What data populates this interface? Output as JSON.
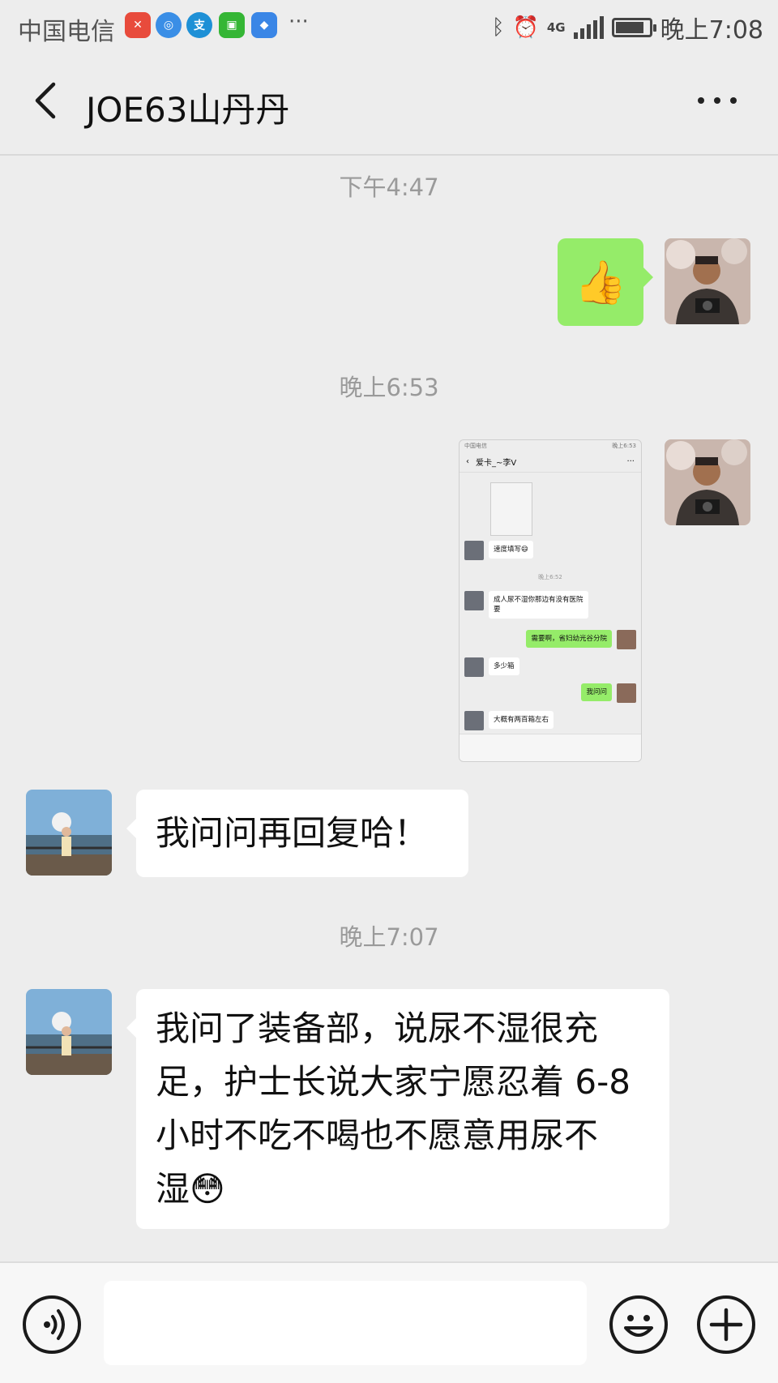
{
  "status_bar": {
    "carrier": "中国电信",
    "more": "···",
    "network": "4G",
    "time": "晚上7:08"
  },
  "header": {
    "title": "JOE63山丹丹"
  },
  "messages": {
    "ts1": "下午4:47",
    "ts2": "晚上6:53",
    "ts3": "晚上7:07",
    "msg1_emoji": "👍",
    "msg3_text": "我问问再回复哈！",
    "msg4_line1": "我问了装备部，说尿不湿很充",
    "msg4_line2": "足，护士长说大家宁愿忍着 6-8",
    "msg4_line3": "小时不吃不喝也不愿意用尿不",
    "msg4_line4": "湿",
    "msg4_emoji": "😳"
  },
  "shared_screenshot": {
    "time": "晚上6:53",
    "title": "爱卡_~李V",
    "more": "···",
    "m1": "速度填写😄",
    "ts": "晚上6:52",
    "m2a": "成人尿不湿你那边有没有医院",
    "m2b": "要",
    "m3": "需要啊，省妇幼光谷分院",
    "m4": "多少箱",
    "m5": "我问问",
    "m6": "大概有两百箱左右"
  },
  "colors": {
    "background": "#ededed",
    "bubble_sent": "#95ec69",
    "bubble_received": "#ffffff",
    "timestamp": "#9a9a9a"
  },
  "icons": {
    "back": "chevron-left-icon",
    "more": "more-dots-icon",
    "voice": "voice-icon",
    "emoji": "emoji-icon",
    "plus": "plus-icon"
  }
}
